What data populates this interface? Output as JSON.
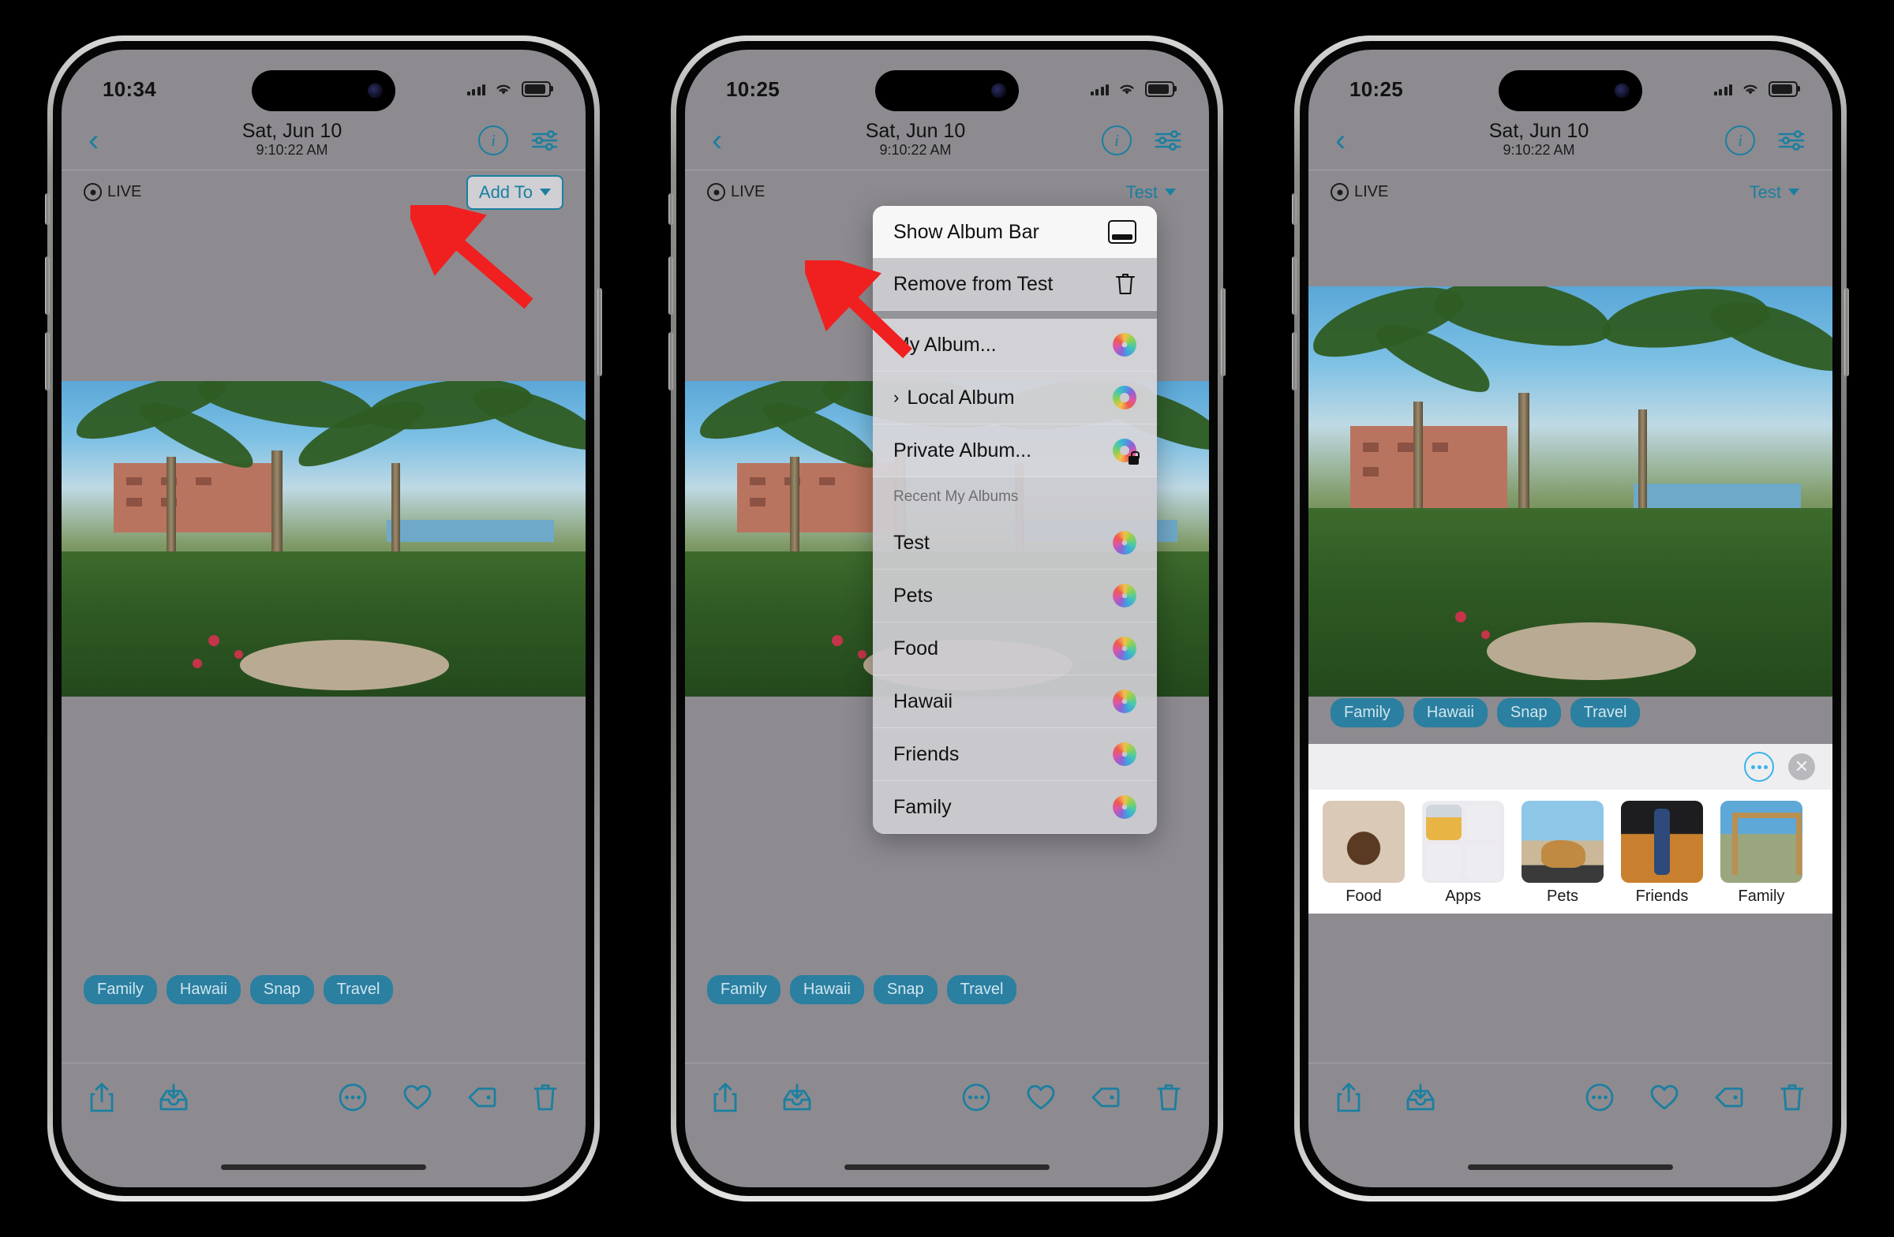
{
  "phones": [
    {
      "id": "phone-1",
      "status": {
        "time": "10:34",
        "battery_level": "80"
      },
      "nav": {
        "back_icon": "chevron-left-icon",
        "date": "Sat, Jun 10",
        "time": "9:10:22 AM",
        "info_icon": "info-circle-icon",
        "adjust_icon": "sliders-icon"
      },
      "album_bar": {
        "live_label": "LIVE",
        "live_icon": "live-photo-icon",
        "right_label": "Add To",
        "right_caret": "chevron-down-icon",
        "highlighted": true
      },
      "tags": [
        "Family",
        "Hawaii",
        "Snap",
        "Travel"
      ],
      "toolbar": {
        "share_icon": "share-up-icon",
        "save_icon": "save-to-tray-icon",
        "more_icon": "ellipsis-circle-icon",
        "favorite_icon": "heart-icon",
        "tag_icon": "tag-icon",
        "delete_icon": "trash-icon"
      }
    },
    {
      "id": "phone-2",
      "status": {
        "time": "10:25",
        "battery_level": "80"
      },
      "nav": {
        "back_icon": "chevron-left-icon",
        "date": "Sat, Jun 10",
        "time": "9:10:22 AM",
        "info_icon": "info-circle-icon",
        "adjust_icon": "sliders-icon"
      },
      "album_bar": {
        "live_label": "LIVE",
        "live_icon": "live-photo-icon",
        "right_label": "Test",
        "right_caret": "chevron-down-icon",
        "highlighted": false
      },
      "menu": {
        "items": [
          {
            "label": "Show Album Bar",
            "icon": "window-bar-icon",
            "highlighted": true,
            "chevron": false
          },
          {
            "label": "Remove from Test",
            "icon": "trash-icon",
            "highlighted": false,
            "chevron": false
          }
        ],
        "album_actions": [
          {
            "label": "My Album...",
            "icon": "photos-flower-icon",
            "chevron": false
          },
          {
            "label": "Local Album",
            "icon": "photos-ring-icon",
            "chevron": true
          },
          {
            "label": "Private Album...",
            "icon": "photos-ring-lock-icon",
            "chevron": false
          }
        ],
        "section_header": "Recent My Albums",
        "recent_albums": [
          {
            "label": "Test",
            "icon": "photos-flower-icon"
          },
          {
            "label": "Pets",
            "icon": "photos-flower-icon"
          },
          {
            "label": "Food",
            "icon": "photos-flower-icon"
          },
          {
            "label": "Hawaii",
            "icon": "photos-flower-icon"
          },
          {
            "label": "Friends",
            "icon": "photos-flower-icon"
          },
          {
            "label": "Family",
            "icon": "photos-flower-icon"
          }
        ]
      },
      "tags": [
        "Family",
        "Hawaii",
        "Snap",
        "Travel"
      ],
      "toolbar": {
        "share_icon": "share-up-icon",
        "save_icon": "save-to-tray-icon",
        "more_icon": "ellipsis-circle-icon",
        "favorite_icon": "heart-icon",
        "tag_icon": "tag-icon",
        "delete_icon": "trash-icon"
      }
    },
    {
      "id": "phone-3",
      "status": {
        "time": "10:25",
        "battery_level": "80"
      },
      "nav": {
        "back_icon": "chevron-left-icon",
        "date": "Sat, Jun 10",
        "time": "9:10:22 AM",
        "info_icon": "info-circle-icon",
        "adjust_icon": "sliders-icon"
      },
      "album_bar": {
        "live_label": "LIVE",
        "live_icon": "live-photo-icon",
        "right_label": "Test",
        "right_caret": "chevron-down-icon",
        "highlighted": false
      },
      "tags": [
        "Family",
        "Hawaii",
        "Snap",
        "Travel"
      ],
      "album_strip": {
        "more_icon": "ellipsis-circle-icon",
        "close_icon": "close-circle-icon",
        "items": [
          {
            "label": "Food",
            "thumb": "dessert-photo"
          },
          {
            "label": "Apps",
            "thumb": "beer-glass-photo"
          },
          {
            "label": "Pets",
            "thumb": "cat-photo"
          },
          {
            "label": "Friends",
            "thumb": "bottle-photo"
          },
          {
            "label": "Family",
            "thumb": "archway-photo"
          }
        ]
      },
      "toolbar": {
        "share_icon": "share-up-icon",
        "save_icon": "save-to-tray-icon",
        "more_icon": "ellipsis-circle-icon",
        "favorite_icon": "heart-icon",
        "tag_icon": "tag-icon",
        "delete_icon": "trash-icon"
      }
    }
  ],
  "annotations": {
    "arrow_1": {
      "name": "red-arrow-pointing-to-add-to",
      "color": "#f02020"
    },
    "arrow_2": {
      "name": "red-arrow-pointing-to-show-album-bar",
      "color": "#f02020"
    }
  },
  "colors": {
    "accent": "#1b7fa0",
    "tag_bg": "#2b7fa0",
    "screen_bg": "#8d8b90",
    "arrow_red": "#f02020"
  }
}
